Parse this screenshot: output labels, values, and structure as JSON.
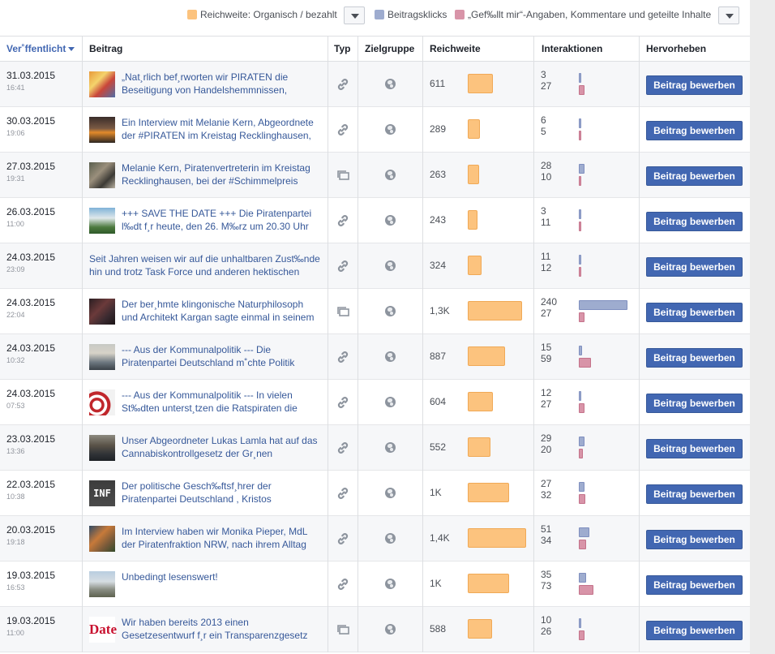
{
  "legend": {
    "items": [
      {
        "label": "Reichweite: Organisch / bezahlt",
        "color": "#fcc37e"
      },
      {
        "label": "Beitragsklicks",
        "color": "#9eaccf"
      },
      {
        "label": "„Gef‰llt mir“-Angaben, Kommentare und geteilte Inhalte",
        "color": "#d894a8"
      }
    ]
  },
  "columns": {
    "published": "Ver˚ffentlicht",
    "post": "Beitrag",
    "type": "Typ",
    "audience": "Zielgruppe",
    "reach": "Reichweite",
    "interactions": "Interaktionen",
    "boost": "Hervorheben"
  },
  "boost_label": "Beitrag bewerben",
  "colors": {
    "reach": "#fcc37e",
    "clicks": "#9eaccf",
    "engagement": "#d894a8",
    "button": "#4267b2",
    "link": "#365899"
  },
  "rows": [
    {
      "date": "31.03.2015",
      "time": "16:41",
      "thumb": "thumb-pirate-collage",
      "text": "„Nat¸rlich bef¸rworten wir PIRATEN die Beseitigung von Handelshemmnissen,",
      "type": "link-icon",
      "reach_label": "611",
      "reach": 611,
      "clicks": 3,
      "engagement": 27
    },
    {
      "date": "30.03.2015",
      "time": "19:06",
      "thumb": "thumb-interview",
      "text": "Ein Interview mit Melanie Kern, Abgeordnete der #PIRATEN im Kreistag Recklinghausen,",
      "type": "link-icon",
      "reach_label": "289",
      "reach": 289,
      "clicks": 6,
      "engagement": 5
    },
    {
      "date": "27.03.2015",
      "time": "19:31",
      "thumb": "thumb-people",
      "text": "Melanie Kern, Piratenvertreterin im Kreistag Recklinghausen, bei der #Schimmelpreis",
      "type": "album-icon",
      "reach_label": "263",
      "reach": 263,
      "clicks": 28,
      "engagement": 10
    },
    {
      "date": "26.03.2015",
      "time": "11:00",
      "thumb": "thumb-event",
      "text": "+++ SAVE THE DATE +++ Die Piratenpartei l‰dt f¸r heute, den 26. M‰rz um 20.30 Uhr",
      "type": "link-icon",
      "reach_label": "243",
      "reach": 243,
      "clicks": 3,
      "engagement": 11
    },
    {
      "date": "24.03.2015",
      "time": "23:09",
      "thumb": "",
      "text": "Seit Jahren weisen wir auf die unhaltbaren Zust‰nde hin und trotz Task Force und anderen hektischen",
      "type": "link-icon",
      "reach_label": "324",
      "reach": 324,
      "clicks": 11,
      "engagement": 12
    },
    {
      "date": "24.03.2015",
      "time": "22:04",
      "thumb": "thumb-klingon",
      "text": "Der ber¸hmte klingonische Naturphilosoph und Architekt Kargan sagte einmal in seinem",
      "type": "album-icon",
      "reach_label": "1,3K",
      "reach": 1300,
      "clicks": 240,
      "engagement": 27
    },
    {
      "date": "24.03.2015",
      "time": "10:32",
      "thumb": "thumb-politician",
      "text": "--- Aus der Kommunalpolitik --- Die Piratenpartei Deutschland m˚chte Politik",
      "type": "link-icon",
      "reach_label": "887",
      "reach": 887,
      "clicks": 15,
      "engagement": 59
    },
    {
      "date": "24.03.2015",
      "time": "07:53",
      "thumb": "thumb-wifi",
      "text": "--- Aus der Kommunalpolitik --- In vielen St‰dten unterst¸tzen die Ratspiraten die",
      "type": "link-icon",
      "reach_label": "604",
      "reach": 604,
      "clicks": 12,
      "engagement": 27
    },
    {
      "date": "23.03.2015",
      "time": "13:36",
      "thumb": "thumb-portrait",
      "text": "Unser Abgeordneter Lukas Lamla hat auf das Cannabiskontrollgesetz der Gr¸nen",
      "type": "link-icon",
      "reach_label": "552",
      "reach": 552,
      "clicks": 29,
      "engagement": 20
    },
    {
      "date": "22.03.2015",
      "time": "10:38",
      "thumb": "thumb-inf",
      "text": "Der politische Gesch‰ftsf¸hrer der Piratenpartei Deutschland , Kristos",
      "type": "link-icon",
      "reach_label": "1K",
      "reach": 1000,
      "clicks": 27,
      "engagement": 32
    },
    {
      "date": "20.03.2015",
      "time": "19:18",
      "thumb": "thumb-group",
      "text": "Im Interview haben wir Monika Pieper, MdL der Piratenfraktion NRW, nach ihrem Alltag",
      "type": "link-icon",
      "reach_label": "1,4K",
      "reach": 1400,
      "clicks": 51,
      "engagement": 34
    },
    {
      "date": "19.03.2015",
      "time": "16:53",
      "thumb": "thumb-building",
      "text": "Unbedingt lesenswert!",
      "type": "link-icon",
      "reach_label": "1K",
      "reach": 1000,
      "clicks": 35,
      "engagement": 73
    },
    {
      "date": "19.03.2015",
      "time": "11:00",
      "thumb": "thumb-date",
      "text": "Wir haben bereits 2013 einen Gesetzesentwurf f¸r ein Transparenzgesetz",
      "type": "album-icon",
      "reach_label": "588",
      "reach": 588,
      "clicks": 10,
      "engagement": 26
    }
  ]
}
